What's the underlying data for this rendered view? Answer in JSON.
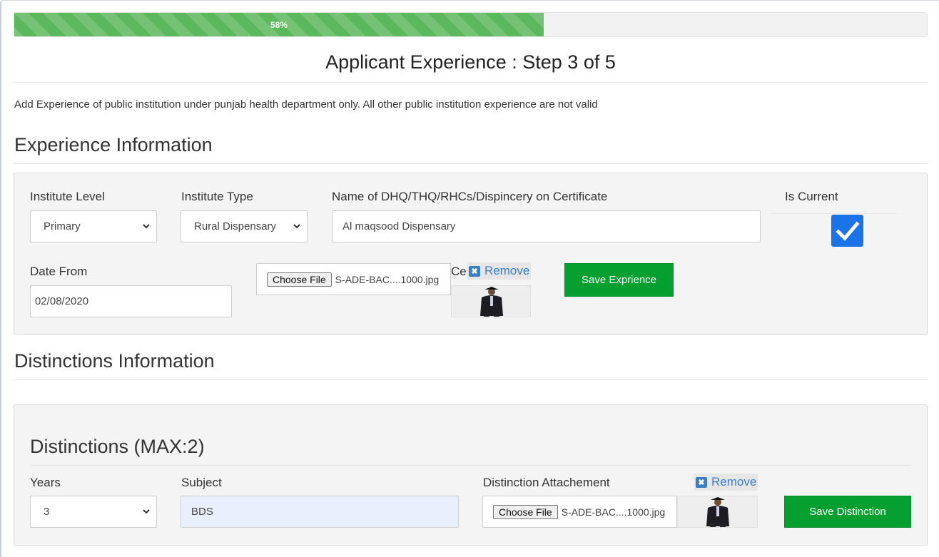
{
  "progress": {
    "percent_label": "58%",
    "percent": 58
  },
  "step_title": "Applicant Experience : Step 3 of 5",
  "note": "Add Experience of public institution under punjab health department only. All other public institution experience are not valid",
  "experience": {
    "section_title": "Experience Information",
    "institute_level_label": "Institute Level",
    "institute_level_value": "Primary",
    "institute_type_label": "Institute Type",
    "institute_type_value": "Rural Dispensary",
    "name_label": "Name of DHQ/THQ/RHCs/Dispincery on Certificate",
    "name_value": "Al maqsood Dispensary",
    "is_current_label": "Is Current",
    "is_current_checked": true,
    "date_from_label": "Date From",
    "date_from_value": "02/08/2020",
    "choose_file_label": "Choose File",
    "file_name": "S-ADE-BAC....1000.jpg",
    "certificate_label_partial": "Cer",
    "remove_label": "Remove",
    "save_button": "Save Exprience"
  },
  "distinctions": {
    "section_title": "Distinctions Information",
    "panel_title": "Distinctions (MAX:2)",
    "years_label": "Years",
    "years_value": "3",
    "subject_label": "Subject",
    "subject_value": "BDS",
    "attachment_label": "Distinction Attachement",
    "remove_label": "Remove",
    "choose_file_label": "Choose File",
    "file_name": "S-ADE-BAC....1000.jpg",
    "save_button": "Save Distinction"
  },
  "colors": {
    "progress": "#5cb85c",
    "save_button": "#05a02f",
    "checkbox": "#1a73e8",
    "link": "#3a7fc2"
  }
}
